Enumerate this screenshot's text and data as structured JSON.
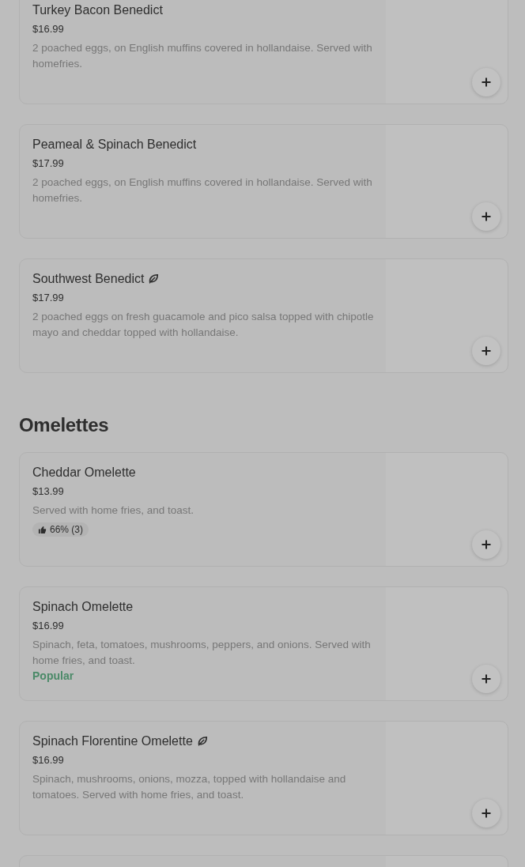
{
  "sections": [
    {
      "items": [
        {
          "name": "Turkey Bacon Benedict",
          "vegetarian": false,
          "price": "$16.99",
          "description": "2 poached eggs, on English muffins covered in hollandaise. Served with homefries."
        },
        {
          "name": "Peameal & Spinach Benedict",
          "vegetarian": false,
          "price": "$17.99",
          "description": "2 poached eggs, on English muffins covered in hollandaise. Served with homefries."
        },
        {
          "name": "Southwest Benedict",
          "vegetarian": true,
          "price": "$17.99",
          "description": "2 poached eggs on fresh guacamole and pico salsa topped with chipotle mayo and cheddar topped with hollandaise."
        }
      ]
    },
    {
      "title": "Omelettes",
      "items": [
        {
          "name": "Cheddar Omelette",
          "vegetarian": false,
          "price": "$13.99",
          "description": "Served with home fries, and toast.",
          "rating": "66% (3)"
        },
        {
          "name": "Spinach Omelette",
          "vegetarian": false,
          "price": "$16.99",
          "description": "Spinach, feta, tomatoes, mushrooms, peppers, and onions. Served with home fries, and toast.",
          "tag": "Popular"
        },
        {
          "name": "Spinach Florentine Omelette",
          "vegetarian": true,
          "price": "$16.99",
          "description": "Spinach, mushrooms, onions, mozza, topped with hollandaise and tomatoes. Served with home fries, and toast."
        }
      ]
    }
  ]
}
